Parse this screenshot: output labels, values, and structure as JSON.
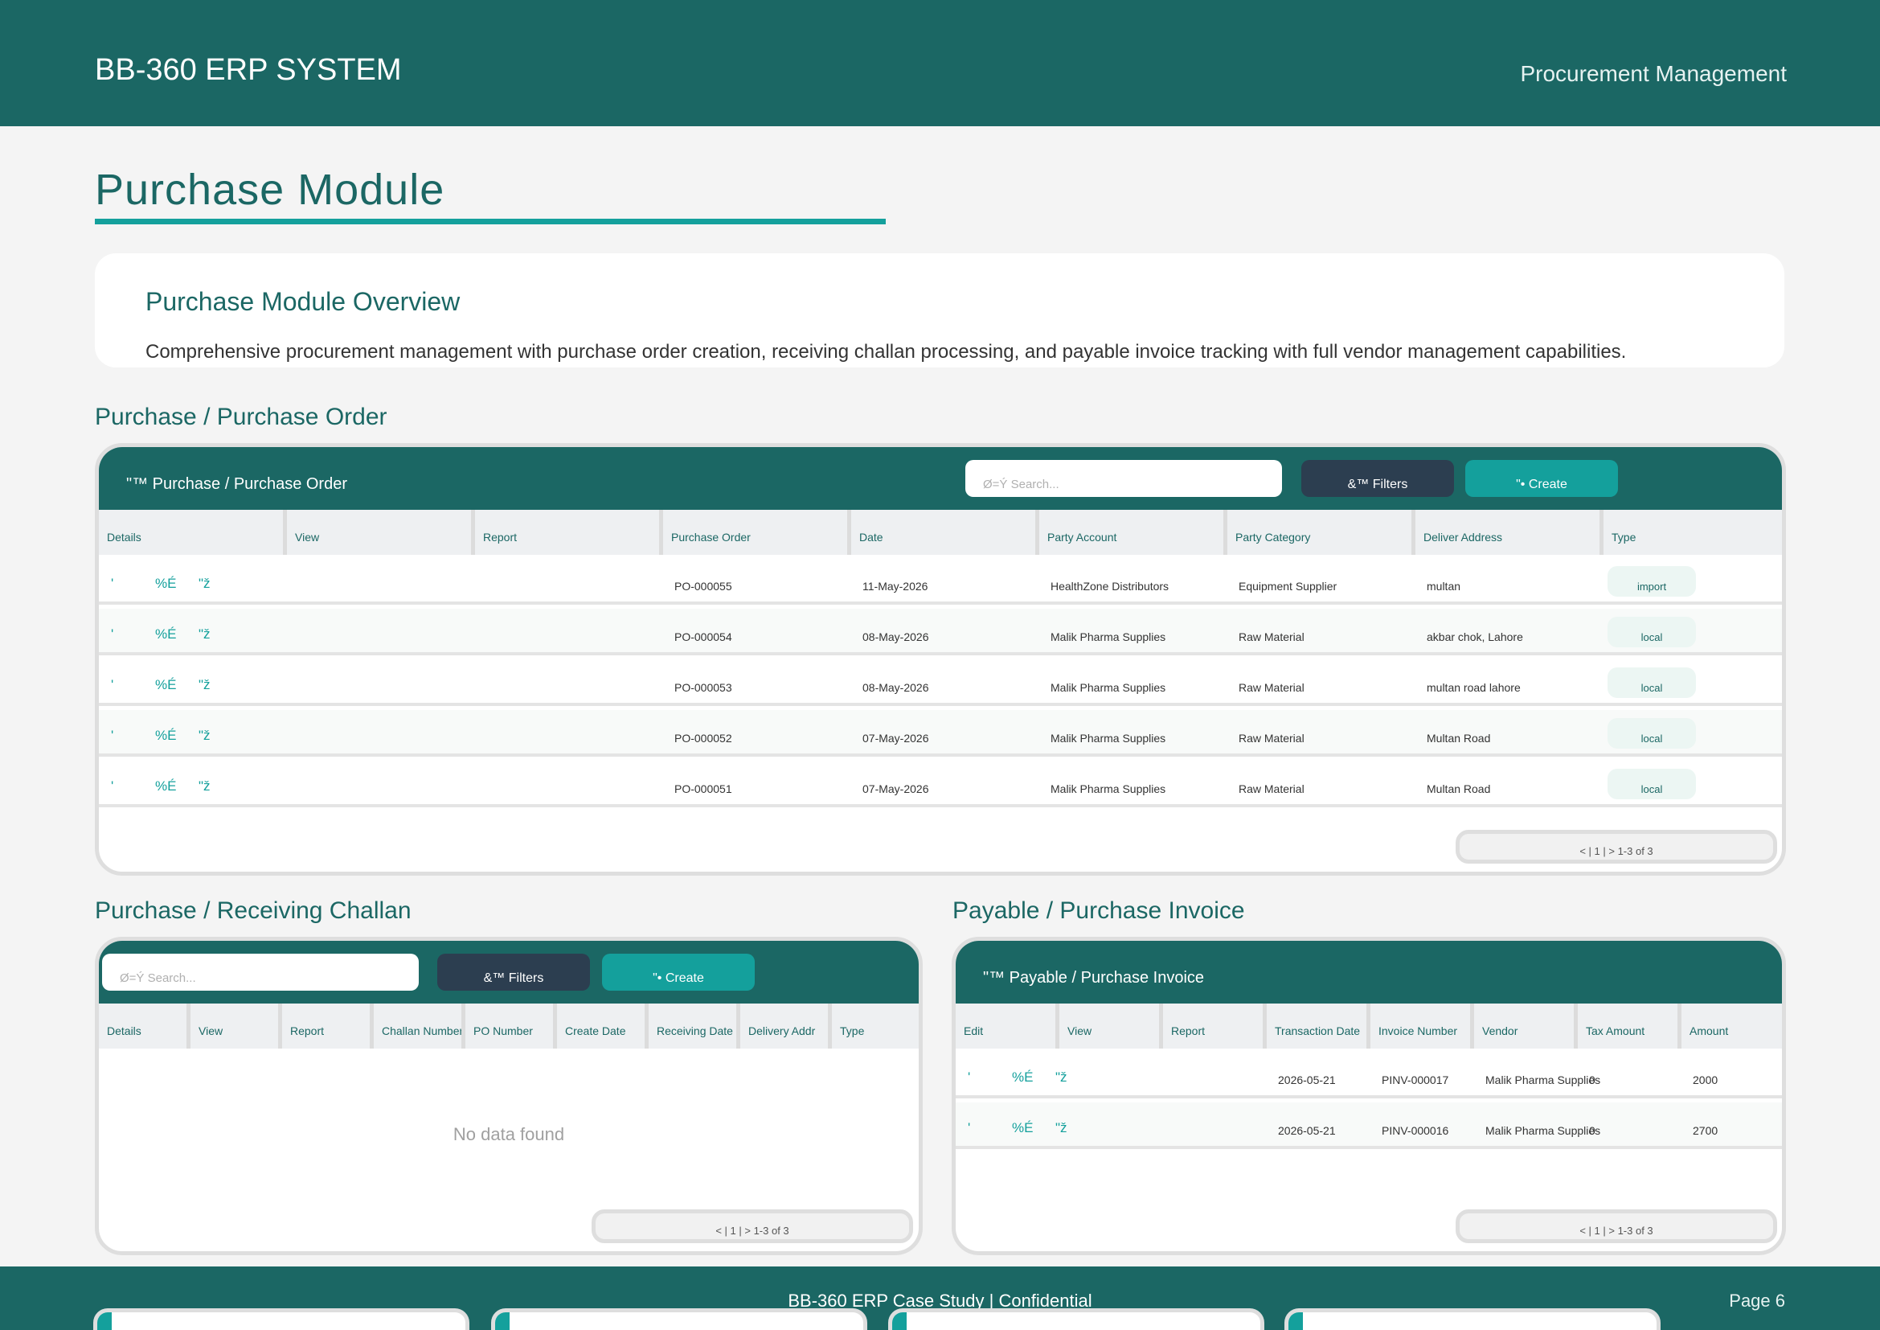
{
  "header": {
    "brand": "BB-360 ERP SYSTEM",
    "section": "Procurement Management"
  },
  "page": {
    "title": "Purchase Module"
  },
  "overview": {
    "heading": "Purchase Module Overview",
    "text": "Comprehensive procurement management with purchase order creation, receiving challan processing, and payable invoice tracking with full vendor management capabilities."
  },
  "purchase_order": {
    "section_label": "Purchase / Purchase Order",
    "panel_title": "\"™ Purchase / Purchase Order",
    "search_placeholder": "Ø=Ý Search...",
    "filters_label": "&™ Filters",
    "create_label": "\"• Create",
    "columns": [
      "Details",
      "View",
      "Report",
      "Purchase Order",
      "Date",
      "Party Account",
      "Party Category",
      "Deliver Address",
      "Type"
    ],
    "actions": [
      "'",
      "%É",
      "\"ž"
    ],
    "rows": [
      {
        "po": "PO-000055",
        "date": "11-May-2026",
        "party": "HealthZone Distributors",
        "category": "Equipment Supplier",
        "address": "multan",
        "type": "import"
      },
      {
        "po": "PO-000054",
        "date": "08-May-2026",
        "party": "Malik Pharma Supplies",
        "category": "Raw Material",
        "address": "akbar chok, Lahore",
        "type": "local"
      },
      {
        "po": "PO-000053",
        "date": "08-May-2026",
        "party": "Malik Pharma Supplies",
        "category": "Raw Material",
        "address": "multan road lahore",
        "type": "local"
      },
      {
        "po": "PO-000052",
        "date": "07-May-2026",
        "party": "Malik Pharma Supplies",
        "category": "Raw Material",
        "address": "Multan Road",
        "type": "local"
      },
      {
        "po": "PO-000051",
        "date": "07-May-2026",
        "party": "Malik Pharma Supplies",
        "category": "Raw Material",
        "address": "Multan Road",
        "type": "local"
      }
    ],
    "pager": "< | 1 | > 1-3 of 3"
  },
  "receiving_challan": {
    "section_label": "Purchase / Receiving Challan",
    "search_placeholder": "Ø=Ý Search...",
    "filters_label": "&™ Filters",
    "create_label": "\"• Create",
    "columns": [
      "Details",
      "View",
      "Report",
      "Challan Number",
      "PO Number",
      "Create Date",
      "Receiving Date",
      "Delivery Addr",
      "Type"
    ],
    "empty_text": "No data found",
    "pager": "< | 1 | > 1-3 of 3"
  },
  "purchase_invoice": {
    "section_label": "Payable / Purchase Invoice",
    "panel_title": "\"™ Payable / Purchase Invoice",
    "columns": [
      "Edit",
      "View",
      "Report",
      "Transaction Date",
      "Invoice Number",
      "Vendor",
      "Tax Amount",
      "Amount"
    ],
    "actions": [
      "'",
      "%É",
      "\"ž"
    ],
    "rows": [
      {
        "date": "2026-05-21",
        "invoice": "PINV-000017",
        "vendor": "Malik Pharma Supplies",
        "tax": "0",
        "amount": "2000"
      },
      {
        "date": "2026-05-21",
        "invoice": "PINV-000016",
        "vendor": "Malik Pharma Supplies",
        "tax": "0",
        "amount": "2700"
      }
    ],
    "pager": "< | 1 | > 1-3 of 3"
  },
  "footer": {
    "center": "BB-360 ERP Case Study  |  Confidential",
    "page": "Page 6"
  },
  "colors": {
    "primary": "#1b6764",
    "accent": "#14a09c",
    "dark_button": "#2c3e50",
    "background": "#f4f4f4"
  }
}
